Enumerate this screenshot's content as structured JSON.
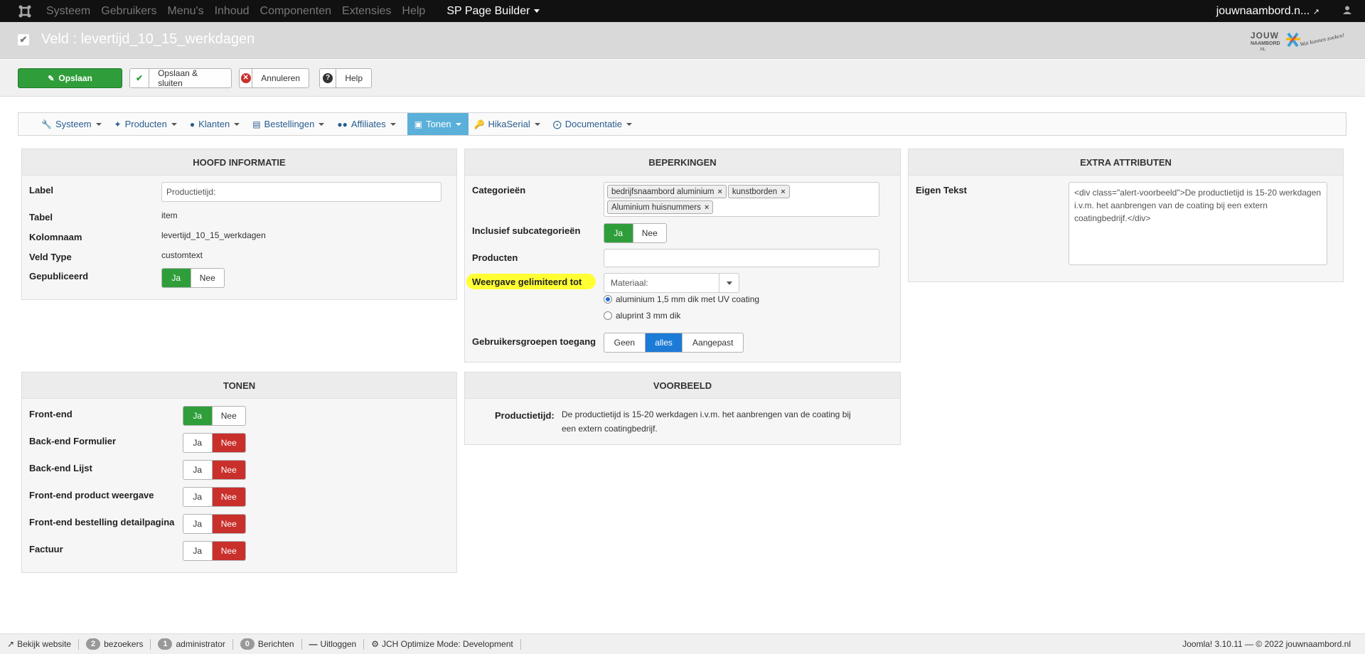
{
  "topbar": {
    "menu": [
      "Systeem",
      "Gebruikers",
      "Menu's",
      "Inhoud",
      "Componenten",
      "Extensies",
      "Help"
    ],
    "active_menu": "SP Page Builder",
    "site_link": "jouwnaambord.n...",
    "user_icon": "user-icon"
  },
  "header": {
    "title": "Veld : levertijd_10_15_werkdagen",
    "logo_text": "JOUW NAAMBORD .NL",
    "logo_tagline": "Wat kunnen zoeken!"
  },
  "toolbar": {
    "save": "Opslaan",
    "save_close": "Opslaan & sluiten",
    "cancel": "Annuleren",
    "help": "Help"
  },
  "menubar": {
    "items": [
      "Systeem",
      "Producten",
      "Klanten",
      "Bestellingen",
      "Affiliates",
      "Tonen",
      "HikaSerial",
      "Documentatie"
    ],
    "active": "Tonen"
  },
  "hoofd": {
    "title": "HOOFD INFORMATIE",
    "label_label": "Label",
    "label_value": "Productietijd:",
    "tabel_label": "Tabel",
    "tabel_value": "item",
    "kolom_label": "Kolomnaam",
    "kolom_value": "levertijd_10_15_werkdagen",
    "type_label": "Veld Type",
    "type_value": "customtext",
    "pub_label": "Gepubliceerd",
    "yes": "Ja",
    "no": "Nee"
  },
  "beperkingen": {
    "title": "BEPERKINGEN",
    "cat_label": "Categorieën",
    "tags": [
      "bedrijfsnaambord aluminium",
      "kunstborden",
      "Aluminium huisnummers"
    ],
    "incl_label": "Inclusief subcategorieën",
    "prod_label": "Producten",
    "weergave_label": "Weergave gelimiteerd tot",
    "select_value": "Materiaal:",
    "radio1": "aluminium 1,5 mm dik met UV coating",
    "radio2": "aluprint 3 mm dik",
    "groep_label": "Gebruikersgroepen toegang",
    "groep_opts": [
      "Geen",
      "alles",
      "Aangepast"
    ]
  },
  "extra": {
    "title": "EXTRA ATTRIBUTEN",
    "label": "Eigen Tekst",
    "text": "<div class=\"alert-voorbeeld\">De productietijd is 15-20 werkdagen i.v.m. het aanbrengen van de coating bij een extern coatingbedrijf.</div>"
  },
  "tonen": {
    "title": "TONEN",
    "rows": [
      "Front-end",
      "Back-end Formulier",
      "Back-end Lijst",
      "Front-end product weergave",
      "Front-end bestelling detailpagina",
      "Factuur"
    ]
  },
  "voorbeeld": {
    "title": "VOORBEELD",
    "label": "Productietijd:",
    "text_line1": "De productietijd is 15-20 werkdagen i.v.m. het aanbrengen van de coating bij",
    "text_line2": "een extern coatingbedrijf."
  },
  "footer": {
    "view_site": "Bekijk website",
    "visitors_count": "2",
    "visitors": "bezoekers",
    "admin_count": "1",
    "admin": "administrator",
    "messages_count": "0",
    "messages": "Berichten",
    "logout": "Uitloggen",
    "jch": "JCH Optimize Mode: Development",
    "version": "Joomla! 3.10.11  —  © 2022 jouwnaambord.nl"
  },
  "colors": {
    "green": "#2f9e3a",
    "red": "#c9302c",
    "blue": "#1d7bd8",
    "highlight": "#ffff33"
  }
}
